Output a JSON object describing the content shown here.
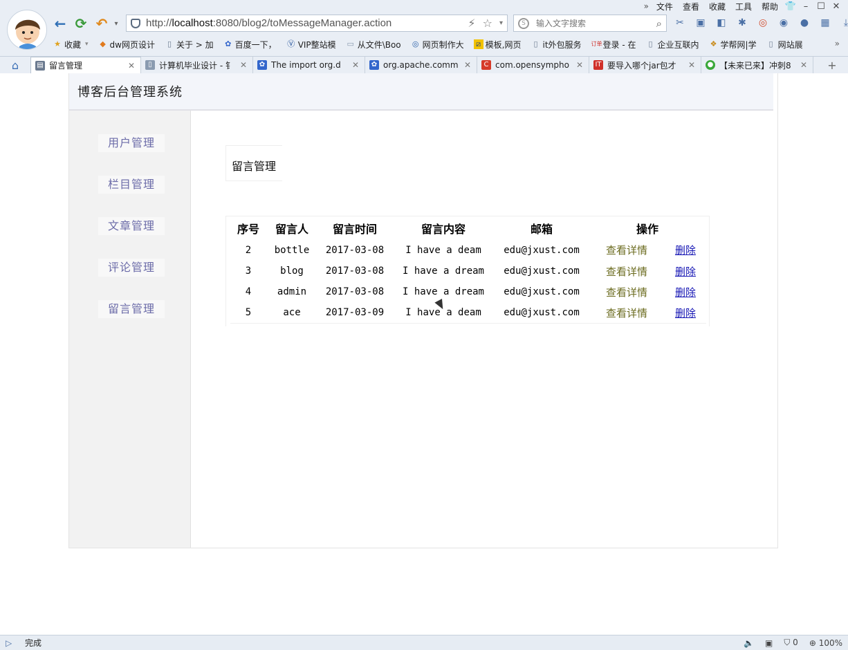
{
  "browser": {
    "menu": [
      "文件",
      "查看",
      "收藏",
      "工具",
      "帮助"
    ],
    "address_url_prefix": "http://",
    "address_url_host": "localhost",
    "address_url_rest": ":8080/blog2/toMessageManager.action",
    "search_placeholder": "输入文字搜索",
    "bookmarks": [
      {
        "label": "收藏",
        "icon": "star-icon"
      },
      {
        "label": "dw网页设计",
        "icon": "page-icon"
      },
      {
        "label": "关于 > 加",
        "icon": "page-icon"
      },
      {
        "label": "百度一下，",
        "icon": "baidu-paw-icon"
      },
      {
        "label": "VIP整站模",
        "icon": "vip-icon"
      },
      {
        "label": "从文件\\Boo",
        "icon": "folder-icon"
      },
      {
        "label": "网页制作大",
        "icon": "globe-icon"
      },
      {
        "label": "模板,网页",
        "icon": "template-icon"
      },
      {
        "label": "it外包服务",
        "icon": "page-icon"
      },
      {
        "label": "登录 - 在",
        "icon": "order-icon"
      },
      {
        "label": "企业互联内",
        "icon": "page-icon"
      },
      {
        "label": "学帮网|学",
        "icon": "book-icon"
      },
      {
        "label": "网站展",
        "icon": "page-icon"
      }
    ],
    "tabs": [
      {
        "title": "留言管理",
        "active": true,
        "icon_color": "#6b7a8f"
      },
      {
        "title": "计算机毕业设计 - 钅",
        "active": false,
        "icon_color": "#8a9bb0"
      },
      {
        "title": "The import org.d",
        "active": false,
        "icon_color": "#3366cc"
      },
      {
        "title": "org.apache.comm",
        "active": false,
        "icon_color": "#3366cc"
      },
      {
        "title": "com.opensympho",
        "active": false,
        "icon_color": "#d63b2a"
      },
      {
        "title": "要导入哪个jar包才",
        "active": false,
        "icon_color": "#d0302a"
      },
      {
        "title": "【未来已来】冲刺8",
        "active": false,
        "icon_color": "#3aa83a"
      }
    ],
    "status_text": "完成",
    "status_right": {
      "shield_count": "0",
      "zoom": "100%"
    }
  },
  "app": {
    "title": "博客后台管理系统",
    "sidebar": [
      {
        "label": "用户管理"
      },
      {
        "label": "栏目管理"
      },
      {
        "label": "文章管理"
      },
      {
        "label": "评论管理"
      },
      {
        "label": "留言管理"
      }
    ],
    "section_title": "留言管理",
    "table": {
      "headers": [
        "序号",
        "留言人",
        "留言时间",
        "留言内容",
        "邮箱",
        "操作"
      ],
      "rows": [
        {
          "id": "2",
          "author": "bottle",
          "date": "2017-03-08",
          "content": "I have a deam",
          "email": "edu@jxust.com",
          "detail": "查看详情",
          "delete": "删除"
        },
        {
          "id": "3",
          "author": "blog",
          "date": "2017-03-08",
          "content": "I have a dream",
          "email": "edu@jxust.com",
          "detail": "查看详情",
          "delete": "删除"
        },
        {
          "id": "4",
          "author": "admin",
          "date": "2017-03-08",
          "content": "I have a dream",
          "email": "edu@jxust.com",
          "detail": "查看详情",
          "delete": "删除"
        },
        {
          "id": "5",
          "author": "ace",
          "date": "2017-03-09",
          "content": "I have a deam",
          "email": "edu@jxust.com",
          "detail": "查看详情",
          "delete": "删除"
        }
      ]
    }
  }
}
